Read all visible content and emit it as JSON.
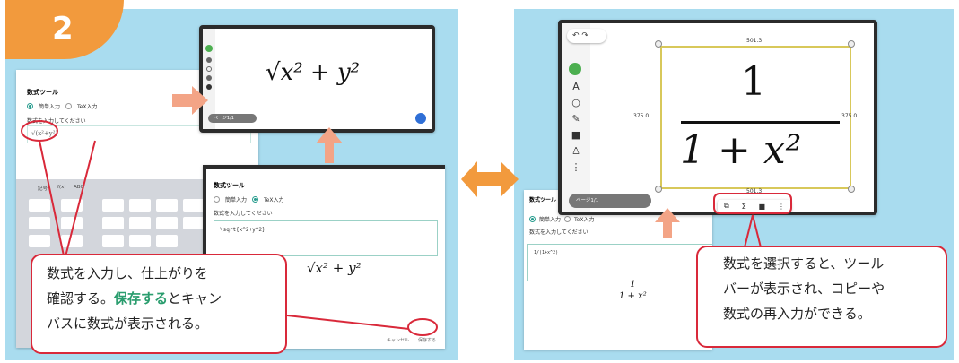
{
  "step_number": "2",
  "left": {
    "formula_window": {
      "title": "数式ツール",
      "radio_simple": "簡単入力",
      "radio_tex": "TeX入力",
      "prompt": "数式を入力してください",
      "input_value": "√(x²+y²)",
      "keyboard_tabs": [
        "記号",
        "f(x)",
        "ABC"
      ]
    },
    "canvas_window": {
      "formula": "√x² + y²",
      "page_indicator": "ページ1/1"
    },
    "front_window": {
      "title": "数式ツール",
      "radio_simple": "簡単入力",
      "radio_tex": "TeX入力",
      "prompt": "数式を入力してください",
      "input_value": "\\sqrt{x^2+y^2}",
      "preview": "√x² + y²",
      "cancel_label": "キャンセル",
      "save_label": "保存する"
    },
    "callout": {
      "line1": "数式を入力し、仕上がりを",
      "line2_before": "確認する。",
      "line2_highlight": "保存する",
      "line2_after": "とキャン",
      "line3": "バスに数式が表示される。"
    }
  },
  "right": {
    "canvas_window": {
      "numerator": "1",
      "denominator": "1 + x²",
      "width_label": "501.3",
      "height_label": "375.0",
      "page_indicator": "ページ1/1"
    },
    "formula_window": {
      "title": "数式ツール",
      "radio_simple": "簡単入力",
      "radio_tex": "TeX入力",
      "prompt": "数式を入力してください",
      "input_value": "1/(1+x^2)",
      "preview_num": "1",
      "preview_den": "1 + x²"
    },
    "callout": {
      "line1": "数式を選択すると、ツール",
      "line2": "バーが表示され、コピーや",
      "line3": "数式の再入力ができる。"
    }
  },
  "colors": {
    "panel": "#a9dcef",
    "badge": "#f29a3d",
    "arrow": "#f3a486",
    "callout_border": "#d9293a",
    "highlight": "#2a9d6e"
  }
}
